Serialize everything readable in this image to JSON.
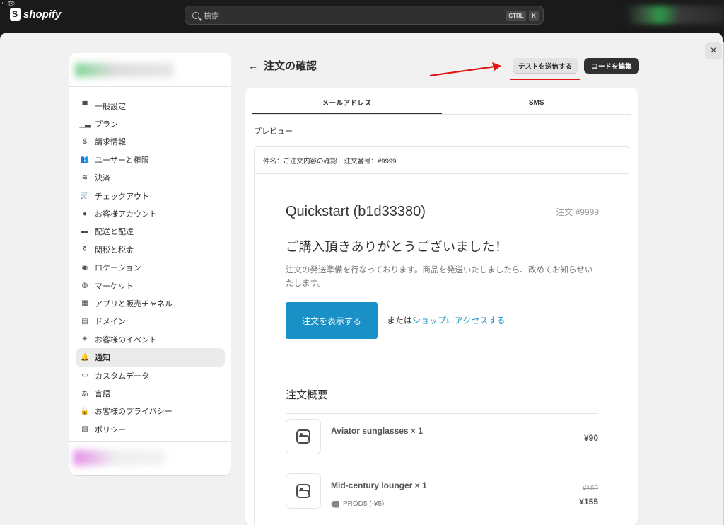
{
  "topbar": {
    "brand": "shopify",
    "search_placeholder": "検索",
    "kbd_ctrl": "CTRL",
    "kbd_k": "K"
  },
  "sidebar": {
    "items": [
      {
        "label": "一般設定",
        "icon": "store-icon"
      },
      {
        "label": "プラン",
        "icon": "plan-chart-icon"
      },
      {
        "label": "請求情報",
        "icon": "billing-icon"
      },
      {
        "label": "ユーザーと権限",
        "icon": "users-icon"
      },
      {
        "label": "決済",
        "icon": "payments-icon"
      },
      {
        "label": "チェックアウト",
        "icon": "cart-icon"
      },
      {
        "label": "お客様アカウント",
        "icon": "person-icon"
      },
      {
        "label": "配送と配達",
        "icon": "truck-icon"
      },
      {
        "label": "関税と税金",
        "icon": "tax-bag-icon"
      },
      {
        "label": "ロケーション",
        "icon": "location-pin-icon"
      },
      {
        "label": "マーケット",
        "icon": "globe-icon"
      },
      {
        "label": "アプリと販売チャネル",
        "icon": "apps-icon"
      },
      {
        "label": "ドメイン",
        "icon": "domain-icon"
      },
      {
        "label": "お客様のイベント",
        "icon": "events-icon"
      },
      {
        "label": "通知",
        "icon": "bell-icon"
      },
      {
        "label": "カスタムデータ",
        "icon": "custom-data-icon"
      },
      {
        "label": "言語",
        "icon": "language-icon"
      },
      {
        "label": "お客様のプライバシー",
        "icon": "lock-icon"
      },
      {
        "label": "ポリシー",
        "icon": "policy-icon"
      }
    ],
    "active_index": 14
  },
  "header": {
    "back_arrow": "←",
    "title": "注文の確認",
    "send_test_label": "テストを送信する",
    "edit_code_label": "コードを編集"
  },
  "tabs": [
    {
      "label": "メールアドレス",
      "active": true
    },
    {
      "label": "SMS",
      "active": false
    }
  ],
  "preview": {
    "label": "プレビュー",
    "subject_prefix": "件名：ご注文内容の確認",
    "subject_order": "注文番号：#9999"
  },
  "email": {
    "shop_name": "Quickstart (b1d33380)",
    "order_number": "注文 #9999",
    "thanks": "ご購入頂きありがとうございました！",
    "body": "注文の発送準備を行なっております。商品を発送いたしましたら、改めてお知らせいたします。",
    "view_order_button": "注文を表示する",
    "or_text": "または",
    "shop_link": "ショップにアクセスする",
    "summary_title": "注文概要",
    "line_items": [
      {
        "name": "Aviator sunglasses × 1",
        "price": "¥90"
      },
      {
        "name": "Mid-century lounger × 1",
        "original_price": "¥160",
        "price": "¥155",
        "discount": "PROD5 (-¥5)"
      }
    ]
  },
  "colors": {
    "accent_button": "#1990c6",
    "highlight": "#e41414",
    "topbar_bg": "#1a1a1a"
  },
  "close_label": "×"
}
